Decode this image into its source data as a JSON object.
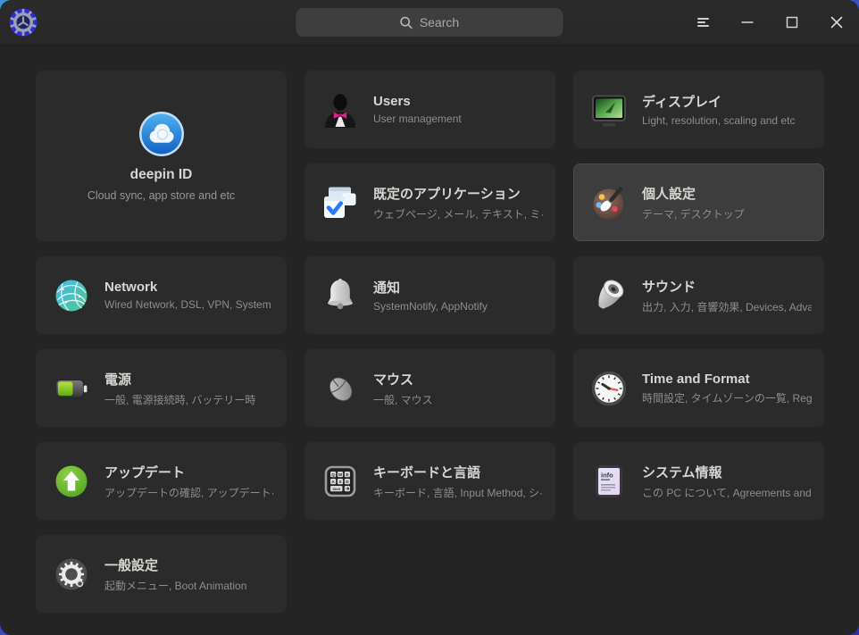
{
  "titlebar": {
    "search_placeholder": "Search",
    "icons": [
      "app-logo-gear",
      "search",
      "menu",
      "minimize",
      "maximize",
      "close"
    ]
  },
  "colors": {
    "desktop_blue": "#3a4ec4",
    "window_bg": "#242424",
    "titlebar_bg": "#2a2a2a",
    "card_bg": "#2b2b2b",
    "card_highlight_bg": "#3d3d3d",
    "title_text": "#d8d6d3",
    "subtitle_text": "#8d8d8d",
    "accent_blue": "#2979ff",
    "update_green": "#5db52e",
    "battery_green": "#7cc21f"
  },
  "cards": {
    "deepin_id": {
      "title": "deepin ID",
      "subtitle": "Cloud sync, app store and etc",
      "icon": "cloud-icon"
    },
    "users": {
      "title": "Users",
      "subtitle": "User management",
      "icon": "person-icon"
    },
    "display": {
      "title": "ディスプレイ",
      "subtitle": "Light, resolution, scaling and etc",
      "icon": "monitor-icon"
    },
    "default_apps": {
      "title": "既定のアプリケーション",
      "subtitle": "ウェブページ, メール, テキスト, ミ···",
      "icon": "windows-check-icon"
    },
    "personalization": {
      "title": "個人設定",
      "subtitle": "テーマ, デスクトップ",
      "icon": "palette-icon"
    },
    "network": {
      "title": "Network",
      "subtitle": "Wired Network, DSL, VPN, System ···",
      "icon": "globe-icon"
    },
    "notification": {
      "title": "通知",
      "subtitle": "SystemNotify, AppNotify",
      "icon": "bell-icon"
    },
    "sound": {
      "title": "サウンド",
      "subtitle": "出力, 入力, 音響効果, Devices, Adva···",
      "icon": "speaker-icon"
    },
    "power": {
      "title": "電源",
      "subtitle": "一般, 電源接続時, バッテリー時",
      "icon": "battery-icon"
    },
    "mouse": {
      "title": "マウス",
      "subtitle": "一般, マウス",
      "icon": "mouse-icon"
    },
    "time": {
      "title": "Time and Format",
      "subtitle": "時間設定, タイムゾーンの一覧, Reg···",
      "icon": "clock-icon"
    },
    "updates": {
      "title": "アップデート",
      "subtitle": "アップデートの確認, アップデート···",
      "icon": "arrow-up-circle-icon"
    },
    "keyboard": {
      "title": "キーボードと言語",
      "subtitle": "キーボード, 言語, Input Method, シ···",
      "icon": "keyboard-icon"
    },
    "system_info": {
      "title": "システム情報",
      "subtitle": "この PC について, Agreements and···",
      "icon": "info-document-icon"
    },
    "general": {
      "title": "一般設定",
      "subtitle": "起動メニュー, Boot Animation",
      "icon": "gear-icon"
    }
  },
  "icon_text": {
    "keyboard_keys": [
      "Q",
      "W",
      "E",
      "A",
      "S",
      "D",
      "Shift"
    ],
    "system_info_label": "info"
  }
}
